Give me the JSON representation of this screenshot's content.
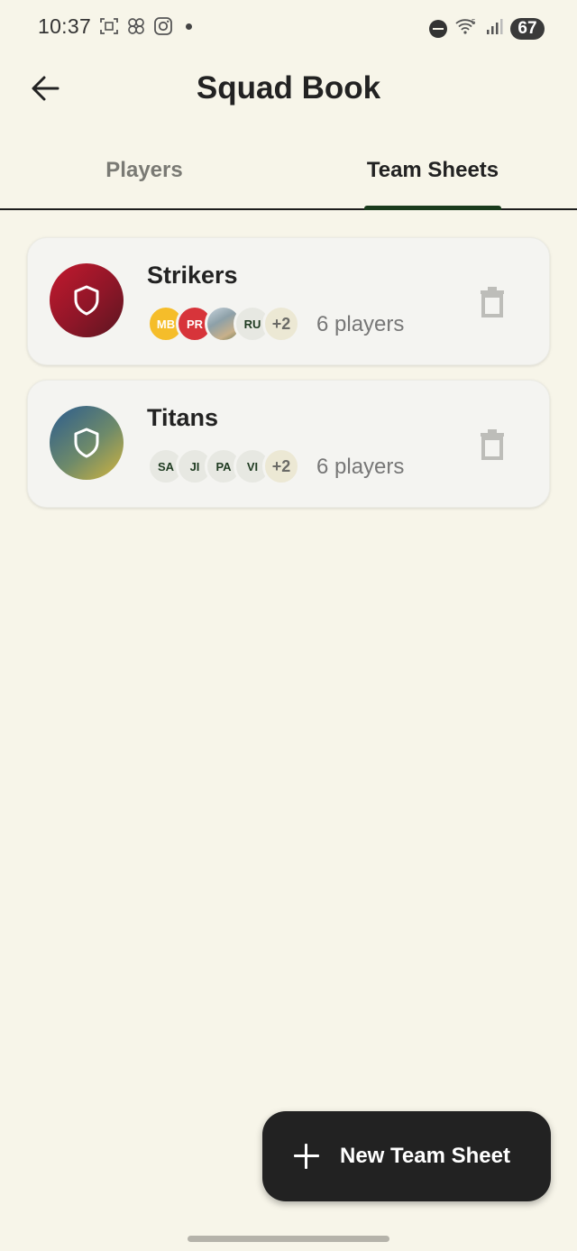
{
  "status_bar": {
    "time": "10:37",
    "battery": "67",
    "icons": [
      "screenshot-icon",
      "pinwheel-icon",
      "instagram-icon",
      "dnd-icon",
      "wifi-icon",
      "signal-icon"
    ]
  },
  "header": {
    "title": "Squad Book",
    "back_icon": "arrow-left-icon"
  },
  "tabs": [
    {
      "label": "Players",
      "selected": false
    },
    {
      "label": "Team Sheets",
      "selected": true
    }
  ],
  "team_sheets": [
    {
      "name": "Strikers",
      "avatars": [
        {
          "initials": "MB",
          "color": "#f5bd2a"
        },
        {
          "initials": "PR",
          "color": "#d7343a"
        },
        {
          "initials": "",
          "photo": true
        },
        {
          "initials": "RU",
          "color": "#e7e8e2"
        }
      ],
      "more": "+2",
      "players": "6 players"
    },
    {
      "name": "Titans",
      "avatars": [
        {
          "initials": "SA",
          "color": "#e7e8e2"
        },
        {
          "initials": "JI",
          "color": "#e7e8e2"
        },
        {
          "initials": "PA",
          "color": "#e7e8e2"
        },
        {
          "initials": "VI",
          "color": "#e7e8e2"
        }
      ],
      "more": "+2",
      "players": "6 players"
    }
  ],
  "fab": {
    "label": "New Team Sheet",
    "icon": "plus-icon"
  },
  "colors": {
    "background": "#f7f5e9",
    "accent_indicator": "#1a3b1c",
    "fab": "#222222"
  }
}
